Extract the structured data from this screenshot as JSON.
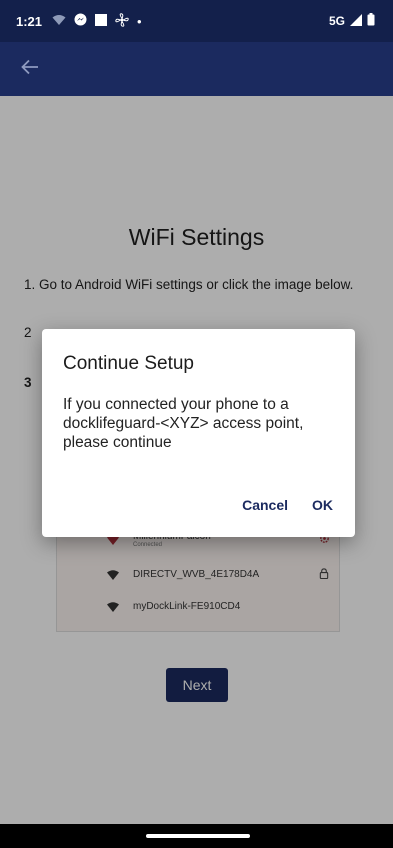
{
  "status_bar": {
    "time": "1:21",
    "dot": "•",
    "network": "5G"
  },
  "app_bar": {
    "back_icon": "arrow-left-icon"
  },
  "page": {
    "title": "WiFi Settings",
    "step1": "1. Go to Android WiFi settings or click the image below.",
    "step2": "2",
    "step3": "3",
    "next_label": "Next"
  },
  "wifi_list": [
    {
      "ssid": "MillenniumFalcon",
      "status": "Connected",
      "icon": "wifi-icon",
      "trailing_icon": "gear-icon"
    },
    {
      "ssid": "DIRECTV_WVB_4E178D4A",
      "icon": "wifi-icon",
      "trailing_icon": "lock-icon"
    },
    {
      "ssid": "myDockLink-FE910CD4",
      "icon": "wifi-icon"
    }
  ],
  "dialog": {
    "title": "Continue Setup",
    "body": "If you connected your phone to a docklifeguard-<XYZ> access point, please continue",
    "cancel_label": "Cancel",
    "ok_label": "OK"
  },
  "colors": {
    "primary": "#1b2a5f",
    "status_bar": "#13204b",
    "connected_wifi": "#b0303a"
  }
}
